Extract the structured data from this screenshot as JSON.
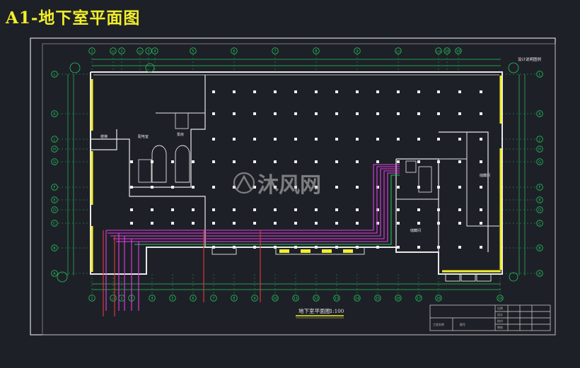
{
  "page_title": "A1-地下室平面图",
  "drawing_title": "地下室平面图",
  "drawing_scale": "1:100",
  "watermark_text": "沐风网",
  "top_right_label": "设计说明图例",
  "colors": {
    "background": "#1e2027",
    "frame": "#d9d9d9",
    "walls": "#e8e8e8",
    "axis": "#22c55e",
    "yellow_wall": "#f2ef2a",
    "pipe_magenta": "#e73ce7",
    "pipe_red": "#e33b3b",
    "title_yellow": "#f2ef2a"
  },
  "axis_top": [
    "1",
    "1/1",
    "2",
    "1/2",
    "3",
    "4",
    "5",
    "6",
    "7",
    "8",
    "9",
    "1/17",
    "1/18",
    "18",
    "19"
  ],
  "axis_bottom": [
    "1",
    "1/1",
    "2",
    "3",
    "4",
    "5",
    "6",
    "7",
    "8",
    "9",
    "10",
    "11",
    "12",
    "13",
    "14",
    "15",
    "16",
    "17",
    "18",
    "19"
  ],
  "axis_rows": [
    "L",
    "K",
    "J",
    "H",
    "G",
    "F",
    "E",
    "D",
    "C",
    "B",
    "A"
  ],
  "room_labels": [
    "楼梯",
    "配电室",
    "泵房",
    "储藏间",
    "储藏间"
  ],
  "title_block_labels": [
    "工程名称",
    "图号",
    "比例",
    "设计",
    "校对",
    "审核"
  ]
}
